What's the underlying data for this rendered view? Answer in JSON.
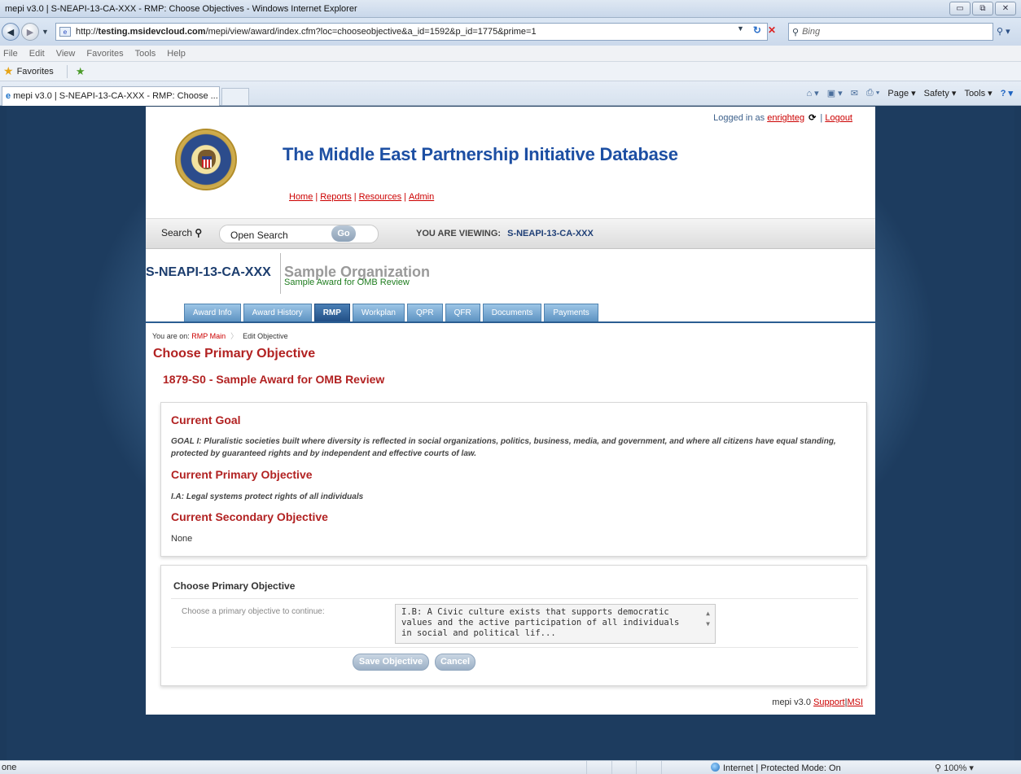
{
  "browser": {
    "window_title": "mepi v3.0 | S-NEAPI-13-CA-XXX - RMP: Choose Objectives - Windows Internet Explorer",
    "url_prefix": "http://",
    "url_host": "testing.msidevcloud.com",
    "url_path": "/mepi/view/award/index.cfm?loc=chooseobjective&a_id=1592&p_id=1775&prime=1",
    "search_placeholder": "Bing",
    "menu": [
      "File",
      "Edit",
      "View",
      "Favorites",
      "Tools",
      "Help"
    ],
    "favorites_label": "Favorites",
    "tab_title": "mepi v3.0 | S-NEAPI-13-CA-XXX - RMP: Choose ...",
    "tools": [
      "Page ▾",
      "Safety ▾",
      "Tools ▾"
    ],
    "status_left": "one",
    "status_zone": "Internet | Protected Mode: On",
    "zoom": "100%"
  },
  "header": {
    "site_title": "The Middle East Partnership Initiative Database",
    "links": [
      "Home",
      "Reports",
      "Resources",
      "Admin"
    ],
    "logged_in_prefix": "Logged in as",
    "username": "enrighteg",
    "logout": "Logout"
  },
  "search": {
    "label": "Search",
    "input_value": "Open Search",
    "go": "Go",
    "viewing_label": "YOU ARE VIEWING:",
    "viewing_code": "S-NEAPI-13-CA-XXX"
  },
  "award": {
    "code": "S-NEAPI-13-CA-XXX",
    "org": "Sample Organization",
    "subtitle": "Sample Award for OMB Review"
  },
  "tabs": [
    {
      "label": "Award Info",
      "active": false
    },
    {
      "label": "Award History",
      "active": false
    },
    {
      "label": "RMP",
      "active": true
    },
    {
      "label": "Workplan",
      "active": false
    },
    {
      "label": "QPR",
      "active": false
    },
    {
      "label": "QFR",
      "active": false
    },
    {
      "label": "Documents",
      "active": false
    },
    {
      "label": "Payments",
      "active": false
    }
  ],
  "breadcrumb": {
    "prefix": "You are on:",
    "items": [
      "RMP Main",
      "Edit Objective"
    ]
  },
  "main": {
    "heading": "Choose Primary Objective",
    "subheading": "1879-S0 - Sample Award for OMB Review"
  },
  "current": {
    "goal_heading": "Current Goal",
    "goal_text": "GOAL I: Pluralistic societies built where diversity is reflected in social organizations, politics, business, media, and government, and where all citizens have equal standing, protected by guaranteed rights and by independent and effective courts of law.",
    "primary_heading": "Current Primary Objective",
    "primary_text": "I.A: Legal systems protect rights of all individuals",
    "secondary_heading": "Current Secondary Objective",
    "secondary_text": "None"
  },
  "form": {
    "title": "Choose Primary Objective",
    "field_label": "Choose a primary objective to continue:",
    "selected_value": "I.B: A Civic culture exists that supports democratic values and the active participation of all individuals in social and political lif...",
    "save": "Save Objective",
    "cancel": "Cancel"
  },
  "footer": {
    "version": "mepi v3.0",
    "support": "Support",
    "msi": "MSI"
  }
}
